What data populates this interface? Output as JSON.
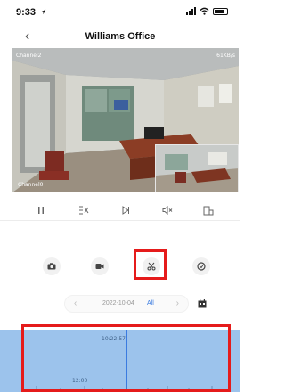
{
  "status_bar": {
    "time": "9:33",
    "time_suffix_icon": "location-arrow-icon",
    "icons": [
      "signal-icon",
      "wifi-icon",
      "battery-icon"
    ]
  },
  "nav": {
    "back_icon": "chevron-left-icon",
    "back_glyph": "‹",
    "title": "Williams Office"
  },
  "video": {
    "channel_label": "Channel2",
    "speed": "61KB/s",
    "pip_channel_label": "Channel0"
  },
  "playback_controls": [
    "pause-icon",
    "speed-icon",
    "playback-mode-icon",
    "mute-icon",
    "fullscreen-icon"
  ],
  "actions": [
    "camera-icon",
    "video-record-icon",
    "scissors-icon",
    "playback-history-icon"
  ],
  "highlighted_action": "scissors-icon",
  "date_bar": {
    "prev_glyph": "‹",
    "date": "2022-10-04",
    "filter": "All",
    "next_glyph": "›",
    "calendar_icon": "calendar-icon"
  },
  "timeline": {
    "cursor_time": "10:22:57",
    "hour_label": "12:00"
  },
  "colors": {
    "accent": "#3a7be0",
    "highlight": "#e51b1b",
    "timeline_bg": "#9cc3ec"
  }
}
